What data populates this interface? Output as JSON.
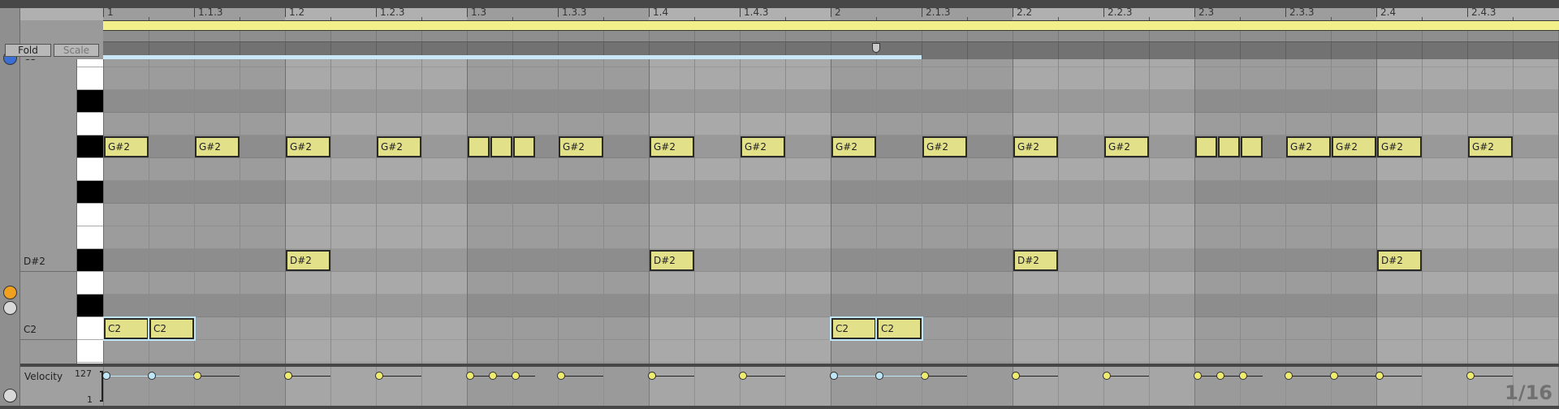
{
  "header": {
    "fold_label": "Fold",
    "scale_label": "Scale"
  },
  "ruler": {
    "labels": [
      {
        "beat": 0,
        "text": "1"
      },
      {
        "beat": 0.5,
        "text": "1.1.3"
      },
      {
        "beat": 1,
        "text": "1.2"
      },
      {
        "beat": 1.5,
        "text": "1.2.3"
      },
      {
        "beat": 2,
        "text": "1.3"
      },
      {
        "beat": 2.5,
        "text": "1.3.3"
      },
      {
        "beat": 3,
        "text": "1.4"
      },
      {
        "beat": 3.5,
        "text": "1.4.3"
      },
      {
        "beat": 4,
        "text": "2"
      },
      {
        "beat": 4.5,
        "text": "2.1.3"
      },
      {
        "beat": 5,
        "text": "2.2"
      },
      {
        "beat": 5.5,
        "text": "2.2.3"
      },
      {
        "beat": 6,
        "text": "2.3"
      },
      {
        "beat": 6.5,
        "text": "2.3.3"
      },
      {
        "beat": 7,
        "text": "2.4"
      },
      {
        "beat": 7.5,
        "text": "2.4.3"
      }
    ]
  },
  "loop": {
    "start_beat": 0,
    "end_beat": 4.5,
    "marker_beat": 4.25
  },
  "keyboard": {
    "top_label": "C3",
    "labels": [
      {
        "pitch": "D#2",
        "row": 9
      },
      {
        "pitch": "C2",
        "row": 12
      }
    ]
  },
  "notes": [
    {
      "pitch": "G#2",
      "row": 4,
      "start": 0,
      "len": 0.25,
      "label": "G#2"
    },
    {
      "pitch": "G#2",
      "row": 4,
      "start": 0.5,
      "len": 0.25,
      "label": "G#2"
    },
    {
      "pitch": "G#2",
      "row": 4,
      "start": 1,
      "len": 0.25,
      "label": "G#2"
    },
    {
      "pitch": "G#2",
      "row": 4,
      "start": 1.5,
      "len": 0.25,
      "label": "G#2"
    },
    {
      "pitch": "G#2",
      "row": 4,
      "start": 2,
      "len": 0.125,
      "label": ""
    },
    {
      "pitch": "G#2",
      "row": 4,
      "start": 2.125,
      "len": 0.125,
      "label": ""
    },
    {
      "pitch": "G#2",
      "row": 4,
      "start": 2.25,
      "len": 0.125,
      "label": ""
    },
    {
      "pitch": "G#2",
      "row": 4,
      "start": 2.5,
      "len": 0.25,
      "label": "G#2"
    },
    {
      "pitch": "G#2",
      "row": 4,
      "start": 3,
      "len": 0.25,
      "label": "G#2"
    },
    {
      "pitch": "G#2",
      "row": 4,
      "start": 3.5,
      "len": 0.25,
      "label": "G#2"
    },
    {
      "pitch": "G#2",
      "row": 4,
      "start": 4,
      "len": 0.25,
      "label": "G#2"
    },
    {
      "pitch": "G#2",
      "row": 4,
      "start": 4.5,
      "len": 0.25,
      "label": "G#2"
    },
    {
      "pitch": "G#2",
      "row": 4,
      "start": 5,
      "len": 0.25,
      "label": "G#2"
    },
    {
      "pitch": "G#2",
      "row": 4,
      "start": 5.5,
      "len": 0.25,
      "label": "G#2"
    },
    {
      "pitch": "G#2",
      "row": 4,
      "start": 6,
      "len": 0.125,
      "label": ""
    },
    {
      "pitch": "G#2",
      "row": 4,
      "start": 6.125,
      "len": 0.125,
      "label": ""
    },
    {
      "pitch": "G#2",
      "row": 4,
      "start": 6.25,
      "len": 0.125,
      "label": ""
    },
    {
      "pitch": "G#2",
      "row": 4,
      "start": 6.5,
      "len": 0.25,
      "label": "G#2"
    },
    {
      "pitch": "G#2",
      "row": 4,
      "start": 6.75,
      "len": 0.25,
      "label": "G#2"
    },
    {
      "pitch": "G#2",
      "row": 4,
      "start": 7,
      "len": 0.25,
      "label": "G#2"
    },
    {
      "pitch": "G#2",
      "row": 4,
      "start": 7.5,
      "len": 0.25,
      "label": "G#2"
    },
    {
      "pitch": "D#2",
      "row": 9,
      "start": 1,
      "len": 0.25,
      "label": "D#2"
    },
    {
      "pitch": "D#2",
      "row": 9,
      "start": 3,
      "len": 0.25,
      "label": "D#2"
    },
    {
      "pitch": "D#2",
      "row": 9,
      "start": 5,
      "len": 0.25,
      "label": "D#2"
    },
    {
      "pitch": "D#2",
      "row": 9,
      "start": 7,
      "len": 0.25,
      "label": "D#2"
    },
    {
      "pitch": "C2",
      "row": 12,
      "start": 0,
      "len": 0.25,
      "label": "C2",
      "selected": true
    },
    {
      "pitch": "C2",
      "row": 12,
      "start": 0.25,
      "len": 0.25,
      "label": "C2",
      "selected": true
    },
    {
      "pitch": "C2",
      "row": 12,
      "start": 4,
      "len": 0.25,
      "label": "C2",
      "selected": true
    },
    {
      "pitch": "C2",
      "row": 12,
      "start": 4.25,
      "len": 0.25,
      "label": "C2",
      "selected": true
    }
  ],
  "velocity": {
    "label": "Velocity",
    "max_label": "127",
    "min_label": "1",
    "value": 127
  },
  "grid_label": "1/16",
  "colors": {
    "note": "#e3e08a",
    "selected": "#bfe6f7",
    "loop": "#f3ef8a"
  }
}
